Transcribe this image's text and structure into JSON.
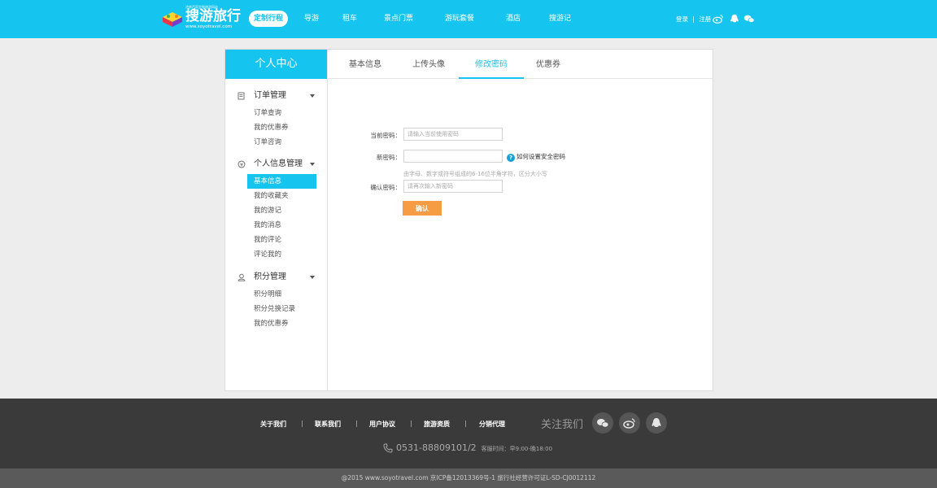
{
  "header": {
    "logo_text": "搜游旅行",
    "logo_tagline": "济南百家定制旅游网站",
    "logo_url": "www.soyotravel.com",
    "nav": [
      "定制行程",
      "导游",
      "租车",
      "景点门票",
      "游玩套餐",
      "酒店",
      "搜游记"
    ],
    "active_nav": "定制行程",
    "login": "登录",
    "register": "注册",
    "separator": "|"
  },
  "sidebar": {
    "title": "个人中心",
    "groups": [
      {
        "title": "订单管理",
        "icon": "order-icon",
        "items": [
          "订单查询",
          "我的优惠券",
          "订单咨询"
        ]
      },
      {
        "title": "个人信息管理",
        "icon": "profile-icon",
        "items": [
          "基本信息",
          "我的收藏夹",
          "我的游记",
          "我的消息",
          "我的评论",
          "评论我的"
        ]
      },
      {
        "title": "积分管理",
        "icon": "points-icon",
        "items": [
          "积分明细",
          "积分兑换记录",
          "我的优惠券"
        ]
      }
    ],
    "active_item": "基本信息"
  },
  "tabs": [
    "基本信息",
    "上传头像",
    "修改密码",
    "优惠券"
  ],
  "active_tab": "修改密码",
  "form": {
    "current_label": "当前密码：",
    "current_placeholder": "请输入当前使用密码",
    "new_label": "新密码：",
    "new_placeholder": "",
    "help_text": "如何设置安全密码",
    "hint": "由字母、数字或符号组成的6-16位半角字符，区分大小写",
    "confirm_label": "确认密码：",
    "confirm_placeholder": "请再次输入新密码",
    "submit": "确认"
  },
  "footer": {
    "links": [
      "关于我们",
      "联系我们",
      "用户协议",
      "旅游资质",
      "分销代理"
    ],
    "separator": "|",
    "follow_label": "关注我们",
    "phone": "0531-88809101/2",
    "hours": "客服时间：早9:00-晚18:00",
    "copyright": "@2015 www.soyotravel.com 京ICP备12013369号-1 旅行社经营许可证L-SD-CJ0012112"
  },
  "colors": {
    "accent": "#15c4ef",
    "button": "#f59c45",
    "footer": "#3a3a3a"
  }
}
